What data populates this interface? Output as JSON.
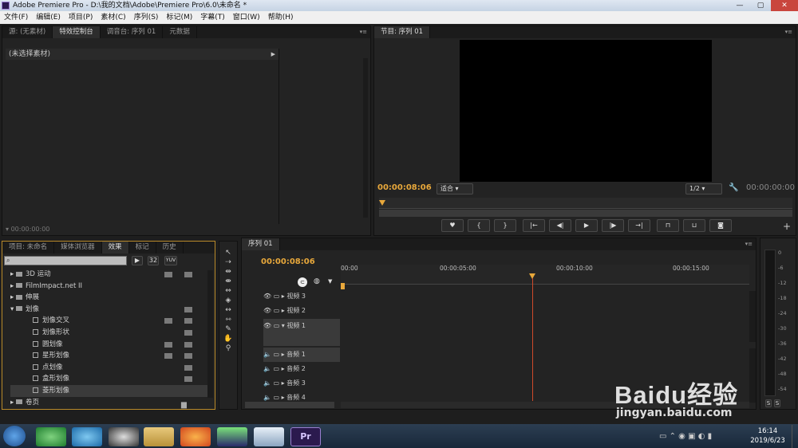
{
  "window": {
    "title": "Adobe Premiere Pro - D:\\我的文档\\Adobe\\Premiere Pro\\6.0\\未命名 *",
    "min": "—",
    "max": "▢",
    "close": "✕"
  },
  "menu": [
    "文件(F)",
    "编辑(E)",
    "项目(P)",
    "素材(C)",
    "序列(S)",
    "标记(M)",
    "字幕(T)",
    "窗口(W)",
    "帮助(H)"
  ],
  "source_tabs": [
    "源: (无素材)",
    "特效控制台",
    "调音台: 序列 01",
    "元数据"
  ],
  "effect_controls": {
    "header": "(未选择素材)",
    "timecode": "00:00:00:00"
  },
  "program": {
    "tab": "节目: 序列 01",
    "timecode": "00:00:08:06",
    "fit": "适合",
    "quality": "1/2",
    "duration": "00:00:00:00"
  },
  "project_tabs": [
    "项目: 未命名",
    "媒体浏览器",
    "效果",
    "标记",
    "历史"
  ],
  "effects": {
    "items": [
      {
        "label": "3D 运动",
        "type": "folder"
      },
      {
        "label": "FilmImpact.net II",
        "type": "folder"
      },
      {
        "label": "伸展",
        "type": "folder"
      },
      {
        "label": "划像",
        "type": "folder-open"
      },
      {
        "label": "划像交叉",
        "type": "fx"
      },
      {
        "label": "划像形状",
        "type": "fx"
      },
      {
        "label": "圆划像",
        "type": "fx"
      },
      {
        "label": "星形划像",
        "type": "fx"
      },
      {
        "label": "点划像",
        "type": "fx"
      },
      {
        "label": "盒形划像",
        "type": "fx"
      },
      {
        "label": "菱形划像",
        "type": "fx"
      },
      {
        "label": "卷页",
        "type": "folder"
      }
    ],
    "search_buttons": [
      "32",
      "YUV"
    ]
  },
  "timeline": {
    "tab": "序列 01",
    "timecode": "00:00:08:06",
    "ruler": [
      "00:00",
      "00:00:05:00",
      "00:00:10:00",
      "00:00:15:00"
    ],
    "tracks": [
      "视频 3",
      "视频 2",
      "视频 1",
      "音频 1",
      "音频 2",
      "音频 3",
      "音频 4"
    ]
  },
  "meters": {
    "scale": [
      "0",
      "-6",
      "-12",
      "-18",
      "-24",
      "-30",
      "-36",
      "-42",
      "-48",
      "-54"
    ],
    "solo": [
      "S",
      "S"
    ]
  },
  "taskbar": {
    "time": "16:14",
    "date": "2019/6/23",
    "pr": "Pr"
  },
  "watermark": {
    "brand": "Baidu经验",
    "url": "jingyan.baidu.com"
  },
  "colors": {
    "accent": "#e8a83b",
    "playhead": "#d04a2a"
  }
}
